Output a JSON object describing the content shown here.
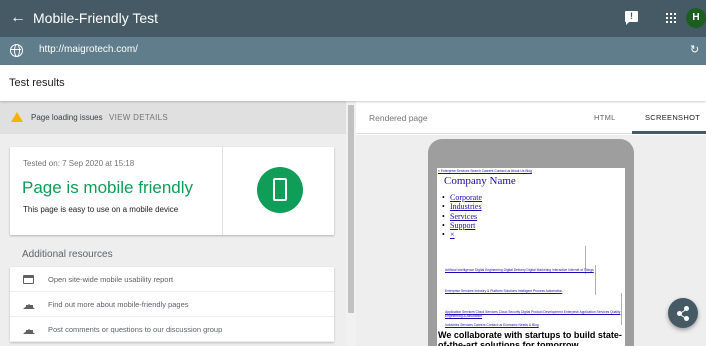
{
  "header": {
    "title": "Mobile-Friendly Test",
    "avatar_letter": "H",
    "feedback_glyph": "!"
  },
  "urlbar": {
    "url": "http://maigrotech.com/"
  },
  "results": {
    "title": "Test results"
  },
  "warning": {
    "text": "Page loading issues",
    "action": "VIEW DETAILS"
  },
  "result_card": {
    "tested_on": "Tested on: 7 Sep 2020 at 15:18",
    "headline": "Page is mobile friendly",
    "subtext": "This page is easy to use on a mobile device"
  },
  "additional": {
    "title": "Additional resources",
    "items": [
      {
        "label": "Open site-wide mobile usability report",
        "icon": "browser-icon"
      },
      {
        "label": "Find out more about mobile-friendly pages",
        "icon": "school-icon"
      },
      {
        "label": "Post comments or questions to our discussion group",
        "icon": "school-icon"
      }
    ]
  },
  "preview": {
    "label": "Rendered page",
    "tabs": [
      "HTML",
      "SCREENSHOT"
    ],
    "active_tab": "SCREENSHOT",
    "site": {
      "topnav": "× Enterprise Services Search Careers Contact us About Us Blog",
      "company": "Company Name",
      "nav": [
        "Corporate",
        "Industries",
        "Services",
        "Support",
        "×"
      ],
      "links": [
        "Artificial Intelligence Digital Engineering Digital Delivery Digital Marketing Interactive Internet of Things",
        "Enterprise Services Industry & Platform Solutions Intelligent Process Automation",
        "Application Services Cloud Services Cloud Security Digital Product Development Enterprise Application Services Quality Engineering & Assurance",
        "Industries Services Careers Contact us Economic Needs & Blog"
      ],
      "tagline": "We collaborate with startups to build state-of-the-art solutions for tomorrow."
    }
  },
  "colors": {
    "appbar": "#455a64",
    "urlbar": "#607d8b",
    "success": "#0f9d58",
    "warning": "#f4b400"
  }
}
